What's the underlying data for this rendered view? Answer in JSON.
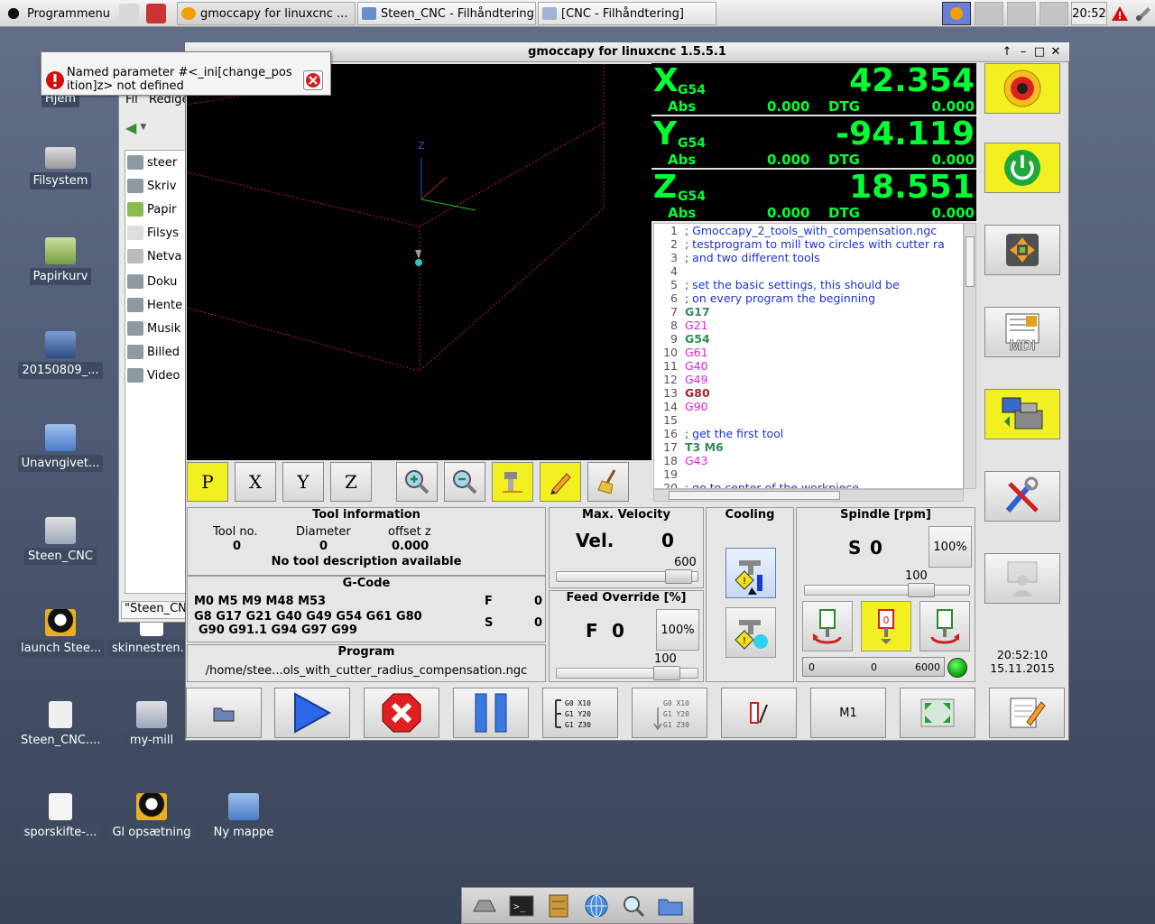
{
  "panel": {
    "menu_label": "Programmenu",
    "tasks": [
      {
        "label": "gmoccapy for linuxcnc  ..."
      },
      {
        "label": "Steen_CNC - Filhåndtering"
      },
      {
        "label": "[CNC - Filhåndtering]"
      }
    ],
    "clock": "20:52"
  },
  "desktop": {
    "icons": [
      {
        "label": "Hjem"
      },
      {
        "label": "Filsystem"
      },
      {
        "label": "Papirkurv"
      },
      {
        "label": "20150809_..."
      },
      {
        "label": "Unavngivet..."
      },
      {
        "label": "Steen_CNC"
      },
      {
        "label": "launch Stee..."
      },
      {
        "label": "skinnestren..."
      },
      {
        "label": "Steen_CNC...."
      },
      {
        "label": "my-mill"
      },
      {
        "label": "sporskifte-..."
      },
      {
        "label": "Gl opsætning"
      },
      {
        "label": "Ny mappe"
      }
    ]
  },
  "filemanager": {
    "menu_file": "Fil",
    "menu_edit": "Redige",
    "items": [
      "steer",
      "Skriv",
      "Papir",
      "Filsys",
      "Netva",
      "Doku",
      "Hente",
      "Musik",
      "Billed",
      "Video"
    ],
    "status": "\"Steen_CN"
  },
  "error": {
    "message": "Named parameter #<_ini[change_position]z> not defined"
  },
  "window": {
    "title": "gmoccapy for linuxcnc  1.5.5.1"
  },
  "view_labels": {
    "p": "P",
    "x": "X",
    "y": "Y",
    "z": "Z",
    "axis_z": "Z"
  },
  "dro": [
    {
      "axis": "X",
      "coord": "G54",
      "value": "42.354",
      "abs_label": "Abs",
      "abs": "0.000",
      "dtg_label": "DTG",
      "dtg": "0.000"
    },
    {
      "axis": "Y",
      "coord": "G54",
      "value": "-94.119",
      "abs_label": "Abs",
      "abs": "0.000",
      "dtg_label": "DTG",
      "dtg": "0.000"
    },
    {
      "axis": "Z",
      "coord": "G54",
      "value": "18.551",
      "abs_label": "Abs",
      "abs": "0.000",
      "dtg_label": "DTG",
      "dtg": "0.000"
    }
  ],
  "code": [
    {
      "n": "1",
      "t": "; Gmoccapy_2_tools_with_compensation.ngc",
      "c": "#1a33d8"
    },
    {
      "n": "2",
      "t": "; testprogram to mill two circles with cutter ra",
      "c": "#1a33d8"
    },
    {
      "n": "3",
      "t": "; and two different tools",
      "c": "#1a33d8"
    },
    {
      "n": "4",
      "t": "",
      "c": "#000"
    },
    {
      "n": "5",
      "t": "; set the basic settings, this should be",
      "c": "#1a33d8"
    },
    {
      "n": "6",
      "t": "; on every program the beginning",
      "c": "#1a33d8"
    },
    {
      "n": "7",
      "t": "G17",
      "c": "#2e8b57"
    },
    {
      "n": "8",
      "t": "G21",
      "c": "#e020e0"
    },
    {
      "n": "9",
      "t": "G54",
      "c": "#2e8b57"
    },
    {
      "n": "10",
      "t": "G61",
      "c": "#e020e0"
    },
    {
      "n": "11",
      "t": "G40",
      "c": "#e020e0"
    },
    {
      "n": "12",
      "t": "G49",
      "c": "#e020e0"
    },
    {
      "n": "13",
      "t": "G80",
      "c": "#a0282a"
    },
    {
      "n": "14",
      "t": "G90",
      "c": "#e020e0"
    },
    {
      "n": "15",
      "t": "",
      "c": "#000"
    },
    {
      "n": "16",
      "t": "; get the first tool",
      "c": "#1a33d8"
    },
    {
      "n": "17",
      "t": "T3 M6",
      "c": "#2e8b57"
    },
    {
      "n": "18",
      "t": "G43",
      "c": "#e020e0"
    },
    {
      "n": "19",
      "t": "",
      "c": "#000"
    },
    {
      "n": "20",
      "t": "; go to center of the workpiece",
      "c": "#1a33d8"
    }
  ],
  "tool": {
    "title": "Tool information",
    "no_label": "Tool no.",
    "no": "0",
    "dia_label": "Diameter",
    "dia": "0",
    "offz_label": "offset z",
    "offz": "0.000",
    "desc": "No tool description available"
  },
  "gcode": {
    "title": "G-Code",
    "line1": "M0 M5 M9 M48 M53",
    "line2": "G8 G17 G21 G40 G49 G54 G61 G80",
    "line3": "G90 G91.1 G94 G97 G99",
    "f_label": "F",
    "f": "0",
    "s_label": "S",
    "s": "0"
  },
  "program": {
    "title": "Program",
    "path": "/home/stee...ols_with_cutter_radius_compensation.ngc"
  },
  "velocity": {
    "title": "Max. Velocity",
    "label": "Vel.",
    "value": "0",
    "max": "600",
    "fraction": 0.95
  },
  "feed": {
    "title": "Feed Override [%]",
    "label": "F",
    "value": "0",
    "pct": "100%",
    "max": "100",
    "fraction": 0.85
  },
  "cooling": {
    "title": "Cooling"
  },
  "spindle": {
    "title": "Spindle [rpm]",
    "label": "S",
    "value": "0",
    "pct": "100%",
    "max": "100",
    "fraction": 0.75,
    "bar_min": "0",
    "bar_val": "0",
    "bar_max": "6000"
  },
  "datetime": {
    "time": "20:52:10",
    "date": "15.11.2015"
  },
  "bottom": {
    "m1": "M1"
  },
  "colors": {
    "dro_green": "#00ff33",
    "button_yellow": "#f2f020",
    "estop_red": "#e02020",
    "led_green": "#00c000"
  }
}
